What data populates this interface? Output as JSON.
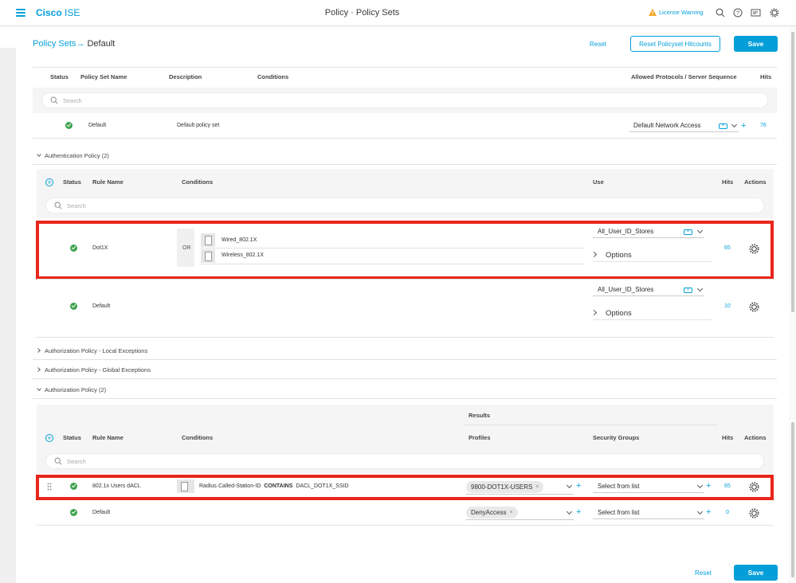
{
  "header": {
    "brand_bold": "Cisco",
    "brand_rest": " ISE",
    "title": "Policy · Policy Sets",
    "license_warning": "License Warning",
    "icons": [
      "menu-icon",
      "warning-icon",
      "search-icon",
      "help-icon",
      "notifications-icon",
      "gear-icon"
    ]
  },
  "breadcrumb": {
    "parent": "Policy Sets",
    "sep": "→",
    "current": "Default"
  },
  "top_actions": {
    "reset": "Reset",
    "reset_hitcounts": "Reset Policyset Hitcounts",
    "save": "Save"
  },
  "policy_set_table": {
    "headers": {
      "status": "Status",
      "name": "Policy Set Name",
      "description": "Description",
      "conditions": "Conditions",
      "protocols": "Allowed Protocols / Server Sequence",
      "hits": "Hits"
    },
    "search_placeholder": "Search",
    "row": {
      "name": "Default",
      "description": "Default policy set",
      "protocol": "Default Network Access",
      "hits": "76"
    }
  },
  "authentication": {
    "title": "Authentication Policy (2)",
    "headers": {
      "status": "Status",
      "rule_name": "Rule Name",
      "conditions": "Conditions",
      "use": "Use",
      "hits": "Hits",
      "actions": "Actions"
    },
    "search_placeholder": "Search",
    "rows": [
      {
        "name": "Dot1X",
        "operator": "OR",
        "conditions": [
          "Wired_802.1X",
          "Wireless_802.1X"
        ],
        "use": "All_User_ID_Stores",
        "options": "Options",
        "hits": "65"
      },
      {
        "name": "Default",
        "use": "All_User_ID_Stores",
        "options": "Options",
        "hits": "10"
      }
    ]
  },
  "collapsed_sections": [
    "Authorization Policy - Local Exceptions",
    "Authorization Policy - Global Exceptions"
  ],
  "authorization": {
    "title": "Authorization Policy (2)",
    "results_label": "Results",
    "headers": {
      "status": "Status",
      "rule_name": "Rule Name",
      "conditions": "Conditions",
      "profiles": "Profiles",
      "security_groups": "Security Groups",
      "hits": "Hits",
      "actions": "Actions"
    },
    "search_placeholder": "Search",
    "rows": [
      {
        "name": "802.1x Users dACL",
        "condition_attr": "Radius·Called-Station-ID",
        "condition_op": "CONTAINS",
        "condition_val": "DACL_DOT1X_SSID",
        "profile": "9800-DOT1X-USERS",
        "security_group": "Select from list",
        "hits": "65"
      },
      {
        "name": "Default",
        "profile": "DenyAccess",
        "security_group": "Select from list",
        "hits": "0"
      }
    ]
  },
  "bottom_actions": {
    "reset": "Reset",
    "save": "Save"
  },
  "colors": {
    "accent": "#049fd9",
    "highlight": "#e8261b",
    "status_ok": "#3fa34d"
  }
}
